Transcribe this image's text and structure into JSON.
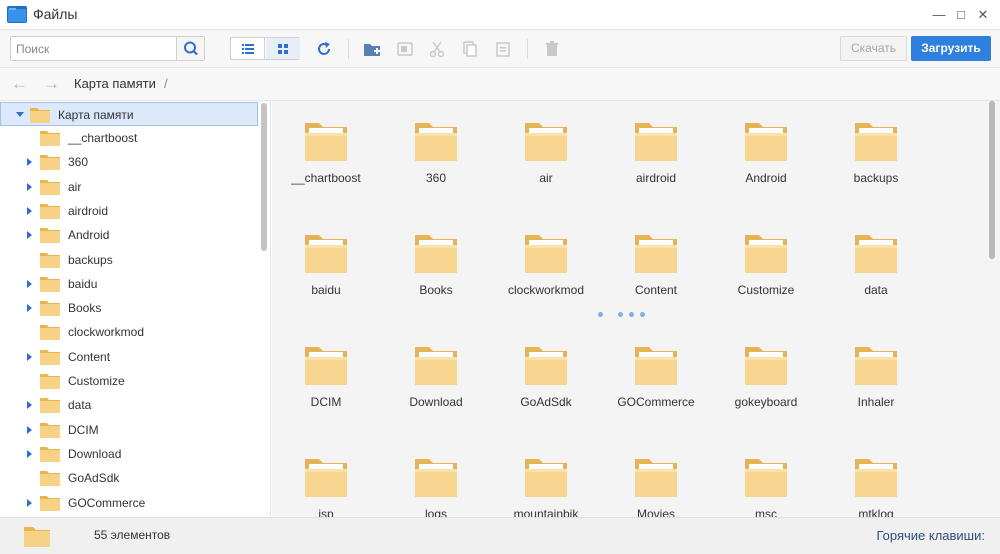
{
  "window": {
    "title": "Файлы",
    "icon": "folder-app-icon"
  },
  "toolbar": {
    "search_placeholder": "Поиск",
    "download_label": "Скачать",
    "upload_label": "Загрузить",
    "accent_color": "#2f7fde"
  },
  "breadcrumb": {
    "root": "Карта памяти",
    "separator": "/"
  },
  "sidebar": {
    "root": "Карта памяти",
    "items": [
      {
        "label": "__chartboost",
        "has_children": false
      },
      {
        "label": "360",
        "has_children": true
      },
      {
        "label": "air",
        "has_children": true
      },
      {
        "label": "airdroid",
        "has_children": true
      },
      {
        "label": "Android",
        "has_children": true
      },
      {
        "label": "backups",
        "has_children": false
      },
      {
        "label": "baidu",
        "has_children": true
      },
      {
        "label": "Books",
        "has_children": true
      },
      {
        "label": "clockworkmod",
        "has_children": false
      },
      {
        "label": "Content",
        "has_children": true
      },
      {
        "label": "Customize",
        "has_children": false
      },
      {
        "label": "data",
        "has_children": true
      },
      {
        "label": "DCIM",
        "has_children": true
      },
      {
        "label": "Download",
        "has_children": true
      },
      {
        "label": "GoAdSdk",
        "has_children": false
      },
      {
        "label": "GOCommerce",
        "has_children": true
      }
    ]
  },
  "files": [
    {
      "name": "__chartboost"
    },
    {
      "name": "360"
    },
    {
      "name": "air"
    },
    {
      "name": "airdroid"
    },
    {
      "name": "Android"
    },
    {
      "name": "backups"
    },
    {
      "name": "baidu"
    },
    {
      "name": "Books"
    },
    {
      "name": "clockworkmod"
    },
    {
      "name": "Content"
    },
    {
      "name": "Customize"
    },
    {
      "name": "data"
    },
    {
      "name": "DCIM"
    },
    {
      "name": "Download"
    },
    {
      "name": "GoAdSdk"
    },
    {
      "name": "GOCommerce"
    },
    {
      "name": "gokeyboard"
    },
    {
      "name": "Inhaler"
    },
    {
      "name": "isp"
    },
    {
      "name": "logs"
    },
    {
      "name": "mountainbik"
    },
    {
      "name": "Movies"
    },
    {
      "name": "msc"
    },
    {
      "name": "mtklog"
    }
  ],
  "status": {
    "count": "55 элементов",
    "hotkeys": "Горячие клавиши:"
  }
}
